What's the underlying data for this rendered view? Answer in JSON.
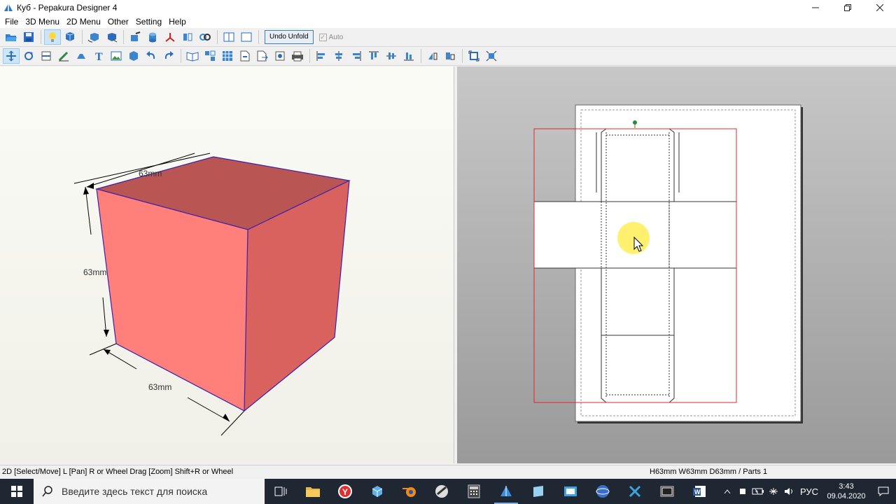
{
  "window": {
    "title": "Куб - Pepakura Designer 4"
  },
  "menu": {
    "items": [
      "File",
      "3D Menu",
      "2D Menu",
      "Other",
      "Setting",
      "Help"
    ]
  },
  "toolbar": {
    "undo_unfold_label": "Undo Unfold",
    "auto_label": "Auto",
    "auto_checked": true
  },
  "view3d": {
    "dim_top": "63mm",
    "dim_left": "63mm",
    "dim_bottom": "63mm"
  },
  "status": {
    "left": "2D [Select/Move] L [Pan] R or Wheel Drag [Zoom] Shift+R or Wheel",
    "right": "H63mm W63mm D63mm / Parts 1"
  },
  "taskbar": {
    "search_placeholder": "Введите здесь текст для поиска",
    "language": "РУС",
    "time": "3:43",
    "date": "09.04.2020"
  },
  "colors": {
    "cube_front": "#ff7f7a",
    "cube_side": "#d9625f",
    "cube_top": "#b95552",
    "print_area": "#e02828"
  }
}
